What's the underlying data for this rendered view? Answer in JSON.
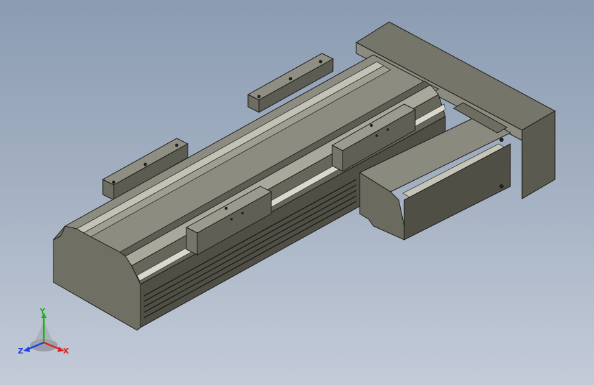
{
  "view": {
    "background_top": "#8b9cb2",
    "background_bottom": "#c3cbd8",
    "model_face_dark": "#55554b",
    "model_face_mid": "#6c6c61",
    "model_face_light": "#8a8a7e",
    "model_face_highlight": "#b7b7ab"
  },
  "triad": {
    "x_label": "X",
    "y_label": "Y",
    "z_label": "Z",
    "x_color": "#e02020",
    "y_color": "#20b020",
    "z_color": "#2040e0"
  }
}
